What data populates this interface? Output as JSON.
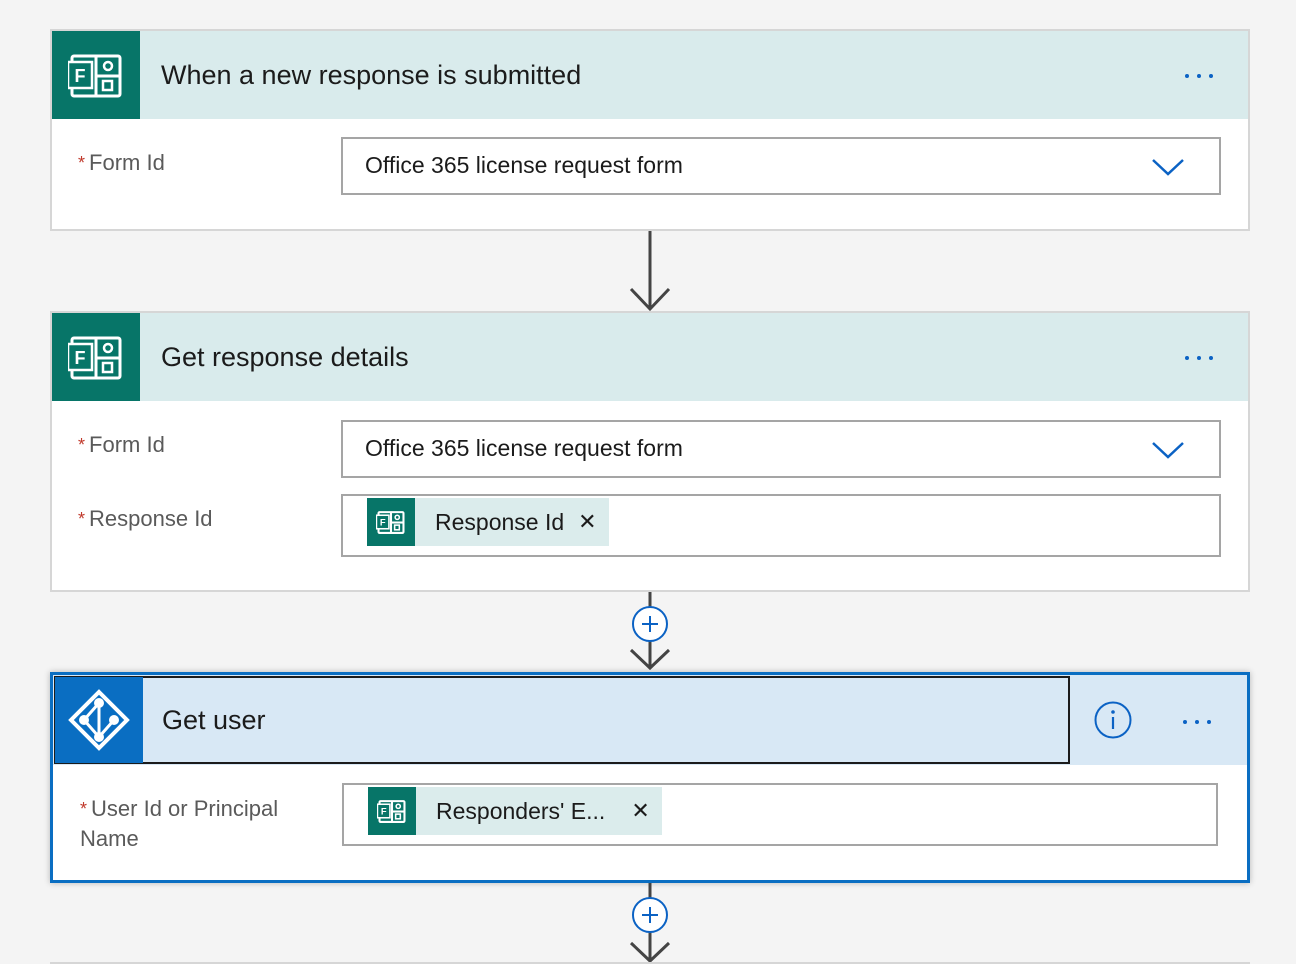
{
  "steps": [
    {
      "title": "When a new response is submitted",
      "fields": [
        {
          "label": "Form Id",
          "required": "*",
          "value": "Office 365 license request form",
          "kind": "dropdown"
        }
      ]
    },
    {
      "title": "Get response details",
      "fields": [
        {
          "label": "Form Id",
          "required": "*",
          "value": "Office 365 license request form",
          "kind": "dropdown"
        },
        {
          "label": "Response Id",
          "required": "*",
          "token": "Response Id",
          "kind": "token"
        }
      ]
    },
    {
      "title": "Get user",
      "fields": [
        {
          "label": "User Id or Principal Name",
          "required": "*",
          "token": "Responders' E...",
          "kind": "token"
        }
      ]
    }
  ],
  "icons": {
    "forms": "microsoft-forms-icon",
    "azure_ad": "azure-ad-icon",
    "info": "info-icon",
    "more": "more-options-icon",
    "chevron": "chevron-down-icon",
    "remove": "remove-token-icon",
    "plus": "add-step-icon",
    "arrow": "arrow-down-icon"
  },
  "colors": {
    "forms_brand": "#077568",
    "azure_brand": "#0a6ec2",
    "header_bg": "#d9ebec",
    "selected_header_bg": "#d8e8f5",
    "accent": "#0b62c4",
    "required": "#c0392b"
  }
}
